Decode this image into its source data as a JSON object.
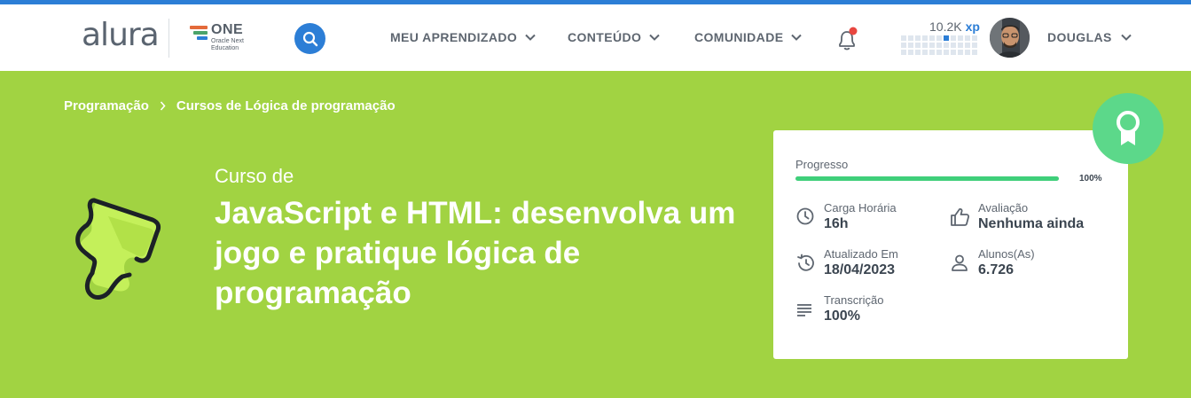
{
  "colors": {
    "hero_bg": "#a1d342",
    "accent_blue": "#2c7ed6",
    "progress_green": "#3fcf7a",
    "badge_green": "#5cd88a",
    "notification_dot": "#e8463f"
  },
  "header": {
    "logo_text": "alura",
    "partner": {
      "title": "ONE",
      "subtitle": "Oracle Next Education"
    },
    "search_icon": "search-icon",
    "nav": [
      {
        "label": "MEU APRENDIZADO",
        "icon": "chevron-down-icon"
      },
      {
        "label": "CONTEÚDO",
        "icon": "chevron-down-icon"
      },
      {
        "label": "COMUNIDADE",
        "icon": "chevron-down-icon"
      }
    ],
    "notifications_icon": "bell-icon",
    "xp": {
      "value": "10.2K",
      "unit": "xp"
    },
    "user": {
      "name": "DOUGLAS",
      "icon": "chevron-down-icon"
    }
  },
  "breadcrumb": [
    {
      "label": "Programação"
    },
    {
      "label": "Cursos de Lógica de programação"
    }
  ],
  "course": {
    "pre_title": "Curso de",
    "title": "JavaScript e HTML: desenvolva um jogo e pratique lógica de programação",
    "icon": "puzzle-icon"
  },
  "card": {
    "progress_label": "Progresso",
    "progress_value": 100,
    "progress_text": "100%",
    "stats": [
      {
        "label": "Carga Horária",
        "value": "16h",
        "icon": "clock-icon"
      },
      {
        "label": "Avaliação",
        "value": "Nenhuma ainda",
        "icon": "thumbs-up-icon"
      },
      {
        "label": "Atualizado Em",
        "value": "18/04/2023",
        "icon": "history-icon"
      },
      {
        "label": "Alunos(As)",
        "value": "6.726",
        "icon": "user-icon"
      },
      {
        "label": "Transcrição",
        "value": "100%",
        "icon": "text-lines-icon"
      }
    ],
    "badge_icon": "award-ribbon-icon"
  }
}
